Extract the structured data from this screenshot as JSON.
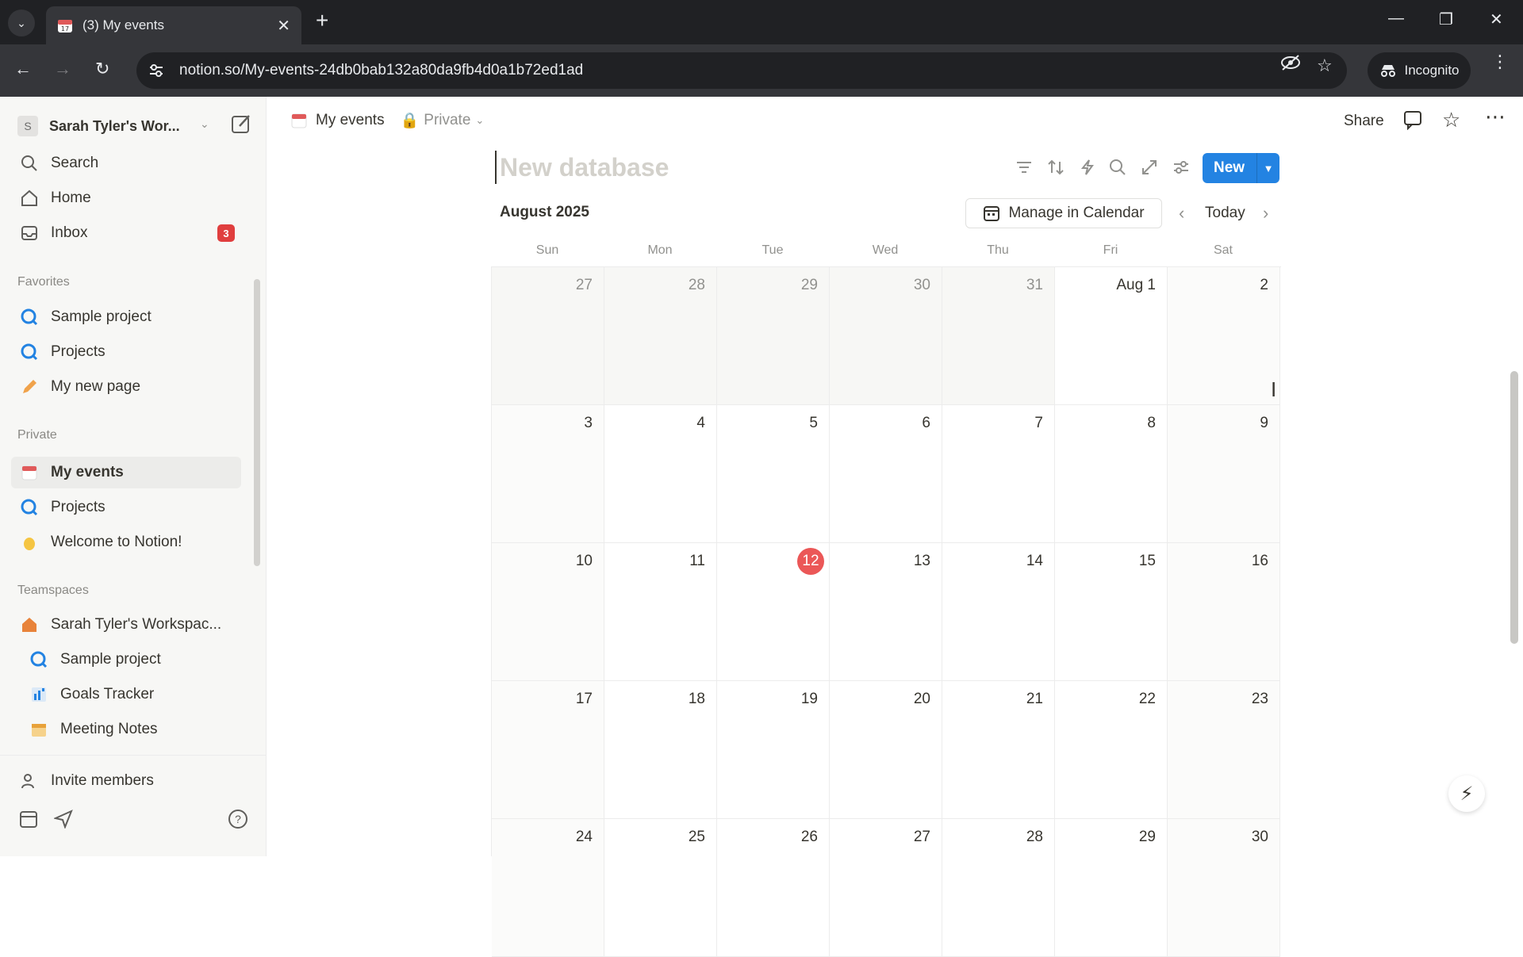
{
  "browser": {
    "tab_title": "(3) My events",
    "url": "notion.so/My-events-24db0bab132a80da9fb4d0a1b72ed1ad",
    "incognito_label": "Incognito"
  },
  "sidebar": {
    "workspace_name": "Sarah Tyler's Wor...",
    "workspace_initial": "S",
    "top_items": [
      {
        "label": "Search",
        "icon": "search-icon"
      },
      {
        "label": "Home",
        "icon": "home-icon"
      },
      {
        "label": "Inbox",
        "icon": "inbox-icon",
        "badge": "3"
      }
    ],
    "favorites_heading": "Favorites",
    "favorites": [
      {
        "label": "Sample project"
      },
      {
        "label": "Projects"
      },
      {
        "label": "My new page"
      }
    ],
    "private_heading": "Private",
    "private": [
      {
        "label": "My events"
      },
      {
        "label": "Projects"
      },
      {
        "label": "Welcome to Notion!"
      }
    ],
    "teamspaces_heading": "Teamspaces",
    "teamspace_name": "Sarah Tyler's Workspac...",
    "teamspace_items": [
      {
        "label": "Sample project"
      },
      {
        "label": "Goals Tracker"
      },
      {
        "label": "Meeting Notes"
      }
    ],
    "invite_label": "Invite members"
  },
  "topbar": {
    "page_title": "My events",
    "privacy": "Private",
    "share_label": "Share"
  },
  "database": {
    "title_placeholder": "New database",
    "new_button": "New",
    "month_label": "August 2025",
    "manage_calendar": "Manage in Calendar",
    "today_label": "Today",
    "weekdays": [
      "Sun",
      "Mon",
      "Tue",
      "Wed",
      "Thu",
      "Fri",
      "Sat"
    ],
    "weeks": [
      [
        "27",
        "28",
        "29",
        "30",
        "31",
        "Aug 1",
        "2"
      ],
      [
        "3",
        "4",
        "5",
        "6",
        "7",
        "8",
        "9"
      ],
      [
        "10",
        "11",
        "12",
        "13",
        "14",
        "15",
        "16"
      ],
      [
        "17",
        "18",
        "19",
        "20",
        "21",
        "22",
        "23"
      ],
      [
        "24",
        "25",
        "26",
        "27",
        "28",
        "29",
        "30"
      ]
    ],
    "today_date": "12"
  },
  "colors": {
    "accent": "#2383e2",
    "today_marker": "#eb5757",
    "badge": "#e03e3e"
  }
}
